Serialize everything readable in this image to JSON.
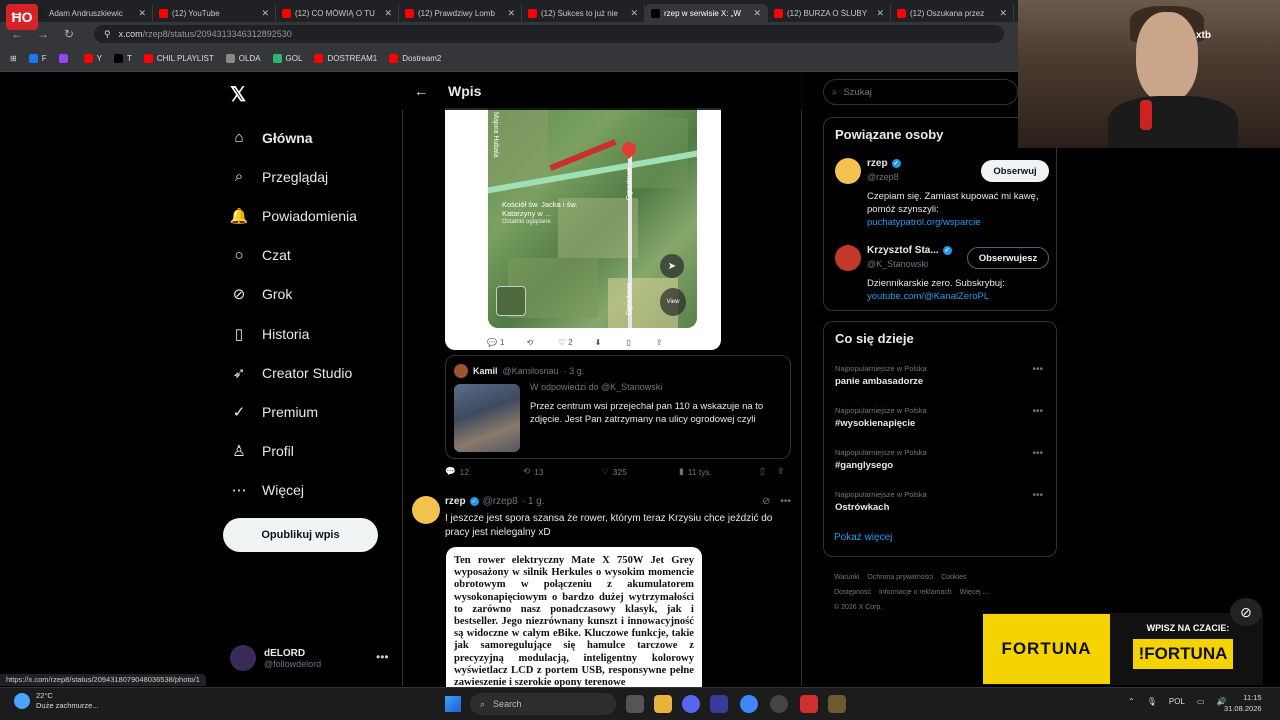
{
  "tabs": [
    {
      "label": "Adam Andruszkiewic",
      "color": "#1d1d1d",
      "active": false
    },
    {
      "label": "(12) YouTube",
      "color": "#ff0000",
      "active": false
    },
    {
      "label": "(12) CO MÓWIĄ O TU",
      "color": "#ff0000",
      "active": false
    },
    {
      "label": "(12) Prawdziwy Lomb",
      "color": "#ff0000",
      "active": false
    },
    {
      "label": "(12) Sukces to już nie",
      "color": "#ff0000",
      "active": false
    },
    {
      "label": "rzep w serwisie X: „W",
      "color": "#000000",
      "active": true
    },
    {
      "label": "(12) BURZA O ŚLUBY",
      "color": "#ff0000",
      "active": false
    },
    {
      "label": "(12) Oszukana przez",
      "color": "#ff0000",
      "active": false
    }
  ],
  "address": {
    "host": "x.com",
    "path": "/rzep8/status/2094313346312892530"
  },
  "bookmarks": [
    {
      "label": "F",
      "color": "#1877f2"
    },
    {
      "label": "",
      "color": "#9146ff"
    },
    {
      "label": "Y",
      "color": "#ff0000"
    },
    {
      "label": "T",
      "color": "#000000"
    },
    {
      "label": "CHIL PLAYLIST",
      "color": "#ff0000"
    },
    {
      "label": "OLDA",
      "color": "#888888"
    },
    {
      "label": "GOL",
      "color": "#2bb673"
    },
    {
      "label": "DOSTREAM1",
      "color": "#ff0000"
    },
    {
      "label": "Dostream2",
      "color": "#ff0000"
    }
  ],
  "overlay_logo": "ĦO",
  "nav": {
    "logo": "𝕏",
    "items": [
      {
        "label": "Główna",
        "icon": "home-icon",
        "glyph": "⌂"
      },
      {
        "label": "Przeglądaj",
        "icon": "search-icon",
        "glyph": "⌕"
      },
      {
        "label": "Powiadomienia",
        "icon": "bell-icon",
        "glyph": "🔔"
      },
      {
        "label": "Czat",
        "icon": "chat-icon",
        "glyph": "○"
      },
      {
        "label": "Grok",
        "icon": "grok-icon",
        "glyph": "⊘"
      },
      {
        "label": "Historia",
        "icon": "bookmark-icon",
        "glyph": "▯"
      },
      {
        "label": "Creator Studio",
        "icon": "rocket-icon",
        "glyph": "➶"
      },
      {
        "label": "Premium",
        "icon": "premium-icon",
        "glyph": "✓"
      },
      {
        "label": "Profil",
        "icon": "profile-icon",
        "glyph": "♙"
      },
      {
        "label": "Więcej",
        "icon": "more-icon",
        "glyph": "⋯"
      }
    ],
    "post_button": "Opublikuj wpis",
    "profile": {
      "name": "dELORD",
      "handle": "@followdelord"
    }
  },
  "main": {
    "header_title": "Wpis",
    "map_actions": [
      {
        "icon": "reply-icon",
        "glyph": "💬",
        "count": "1"
      },
      {
        "icon": "retweet-icon",
        "glyph": "⟲",
        "count": ""
      },
      {
        "icon": "like-icon",
        "glyph": "♡",
        "count": "2"
      },
      {
        "icon": "dislike-icon",
        "glyph": "⬇",
        "count": ""
      },
      {
        "icon": "bookmark-icon",
        "glyph": "▯",
        "count": ""
      },
      {
        "icon": "share-icon",
        "glyph": "⇪",
        "count": ""
      }
    ],
    "map_labels": {
      "street_top": "Majora Hubala",
      "church": "Kościół św. Jacka i św. Katarzyny w ...",
      "recent": "Ostatnio oglądane",
      "street_right": "Ogrodowa",
      "street_bottom": "Ogrodowa",
      "view": "View"
    },
    "quote": {
      "name": "Kamil",
      "handle": "@Kamilosnau",
      "time": "· 3 g.",
      "reply_to": "W odpowiedzi do @K_Stanowski",
      "text": "Przez centrum wsi przejechał pan 110 a wskazuje na to zdjęcie. Jest Pan zatrzymany na ulicy ogrodowej czyli"
    },
    "stats": [
      {
        "icon": "reply-icon",
        "glyph": "💬",
        "value": "12"
      },
      {
        "icon": "retweet-icon",
        "glyph": "⟲",
        "value": "13"
      },
      {
        "icon": "like-icon",
        "glyph": "♡",
        "value": "325"
      },
      {
        "icon": "views-icon",
        "glyph": "▮",
        "value": "11 tys."
      }
    ],
    "tweet2": {
      "name": "rzep",
      "handle": "@rzep8",
      "time": "· 1 g.",
      "text": "I jeszcze jest spora szansa że rower, którym teraz Krzysiu chce jeździć do pracy jest nielegalny xD",
      "image_text": "Ten rower elektryczny Mate X 750W Jet Grey wyposażony w silnik Herkules o wysokim momencie obrotowym w połączeniu z akumulatorem wysokonapięciowym o bardzo dużej wytrzymałości to zarówno nasz ponadczasowy klasyk, jak i bestseller. Jego niezrównany kunszt i innowacyjność są widoczne w całym eBike. Kluczowe funkcje, takie jak samoregulujące się hamulce tarczowe z precyzyjną modulacją, inteligentny kolorowy wyświetlacz LCD z portem USB, responsywne pełne zawieszenie i szerokie opony terenowe"
    }
  },
  "right": {
    "search_placeholder": "Szukaj",
    "related_title": "Powiązane osoby",
    "people": [
      {
        "name": "rzep",
        "handle": "@rzep8",
        "button": "Obserwuj",
        "bio": "Czepiam się. Zamiast kupować mi kawę, pomóż szynszyli:",
        "link": "puchatypatrol.org/wsparcie",
        "avatar_color": "#f2c14e"
      },
      {
        "name": "Krzysztof Sta...",
        "handle": "@K_Stanowski",
        "button": "Obserwujesz",
        "bio": "Dziennikarskie zero. Subskrybuj:",
        "link": "youtube.com/@KanalZeroPL",
        "avatar_color": "#c0392b"
      }
    ],
    "trends_title": "Co się dzieje",
    "trends": [
      {
        "context": "Najpopularniejsze w Polska",
        "title": "panie ambasadorze"
      },
      {
        "context": "Najpopularniejsze w Polska",
        "title": "#wysokienapięcie"
      },
      {
        "context": "Najpopularniejsze w Polska",
        "title": "#ganglysego"
      },
      {
        "context": "Najpopularniejsze w Polska",
        "title": "Ostrówkach"
      }
    ],
    "show_more": "Pokaż więcej",
    "footer": [
      "Warunki",
      "Ochrona prywatności",
      "Cookies",
      "Dostępność",
      "Informacje o reklamach",
      "Więcej ...",
      "© 2026 X Corp."
    ]
  },
  "overlay": {
    "webcam_brand": "xtb",
    "ad_brand": "FORTUNA",
    "ad_line": "WPISZ NA CZACIE:",
    "ad_code": "!FORTUNA"
  },
  "status_url": "https://x.com/rzep8/status/2094318079048036538/photo/1",
  "taskbar": {
    "temp": "22°C",
    "weather": "Duże zachmurze...",
    "search_placeholder": "Search",
    "lang": "POL",
    "time": "11:15",
    "date": "31.08.2026"
  }
}
